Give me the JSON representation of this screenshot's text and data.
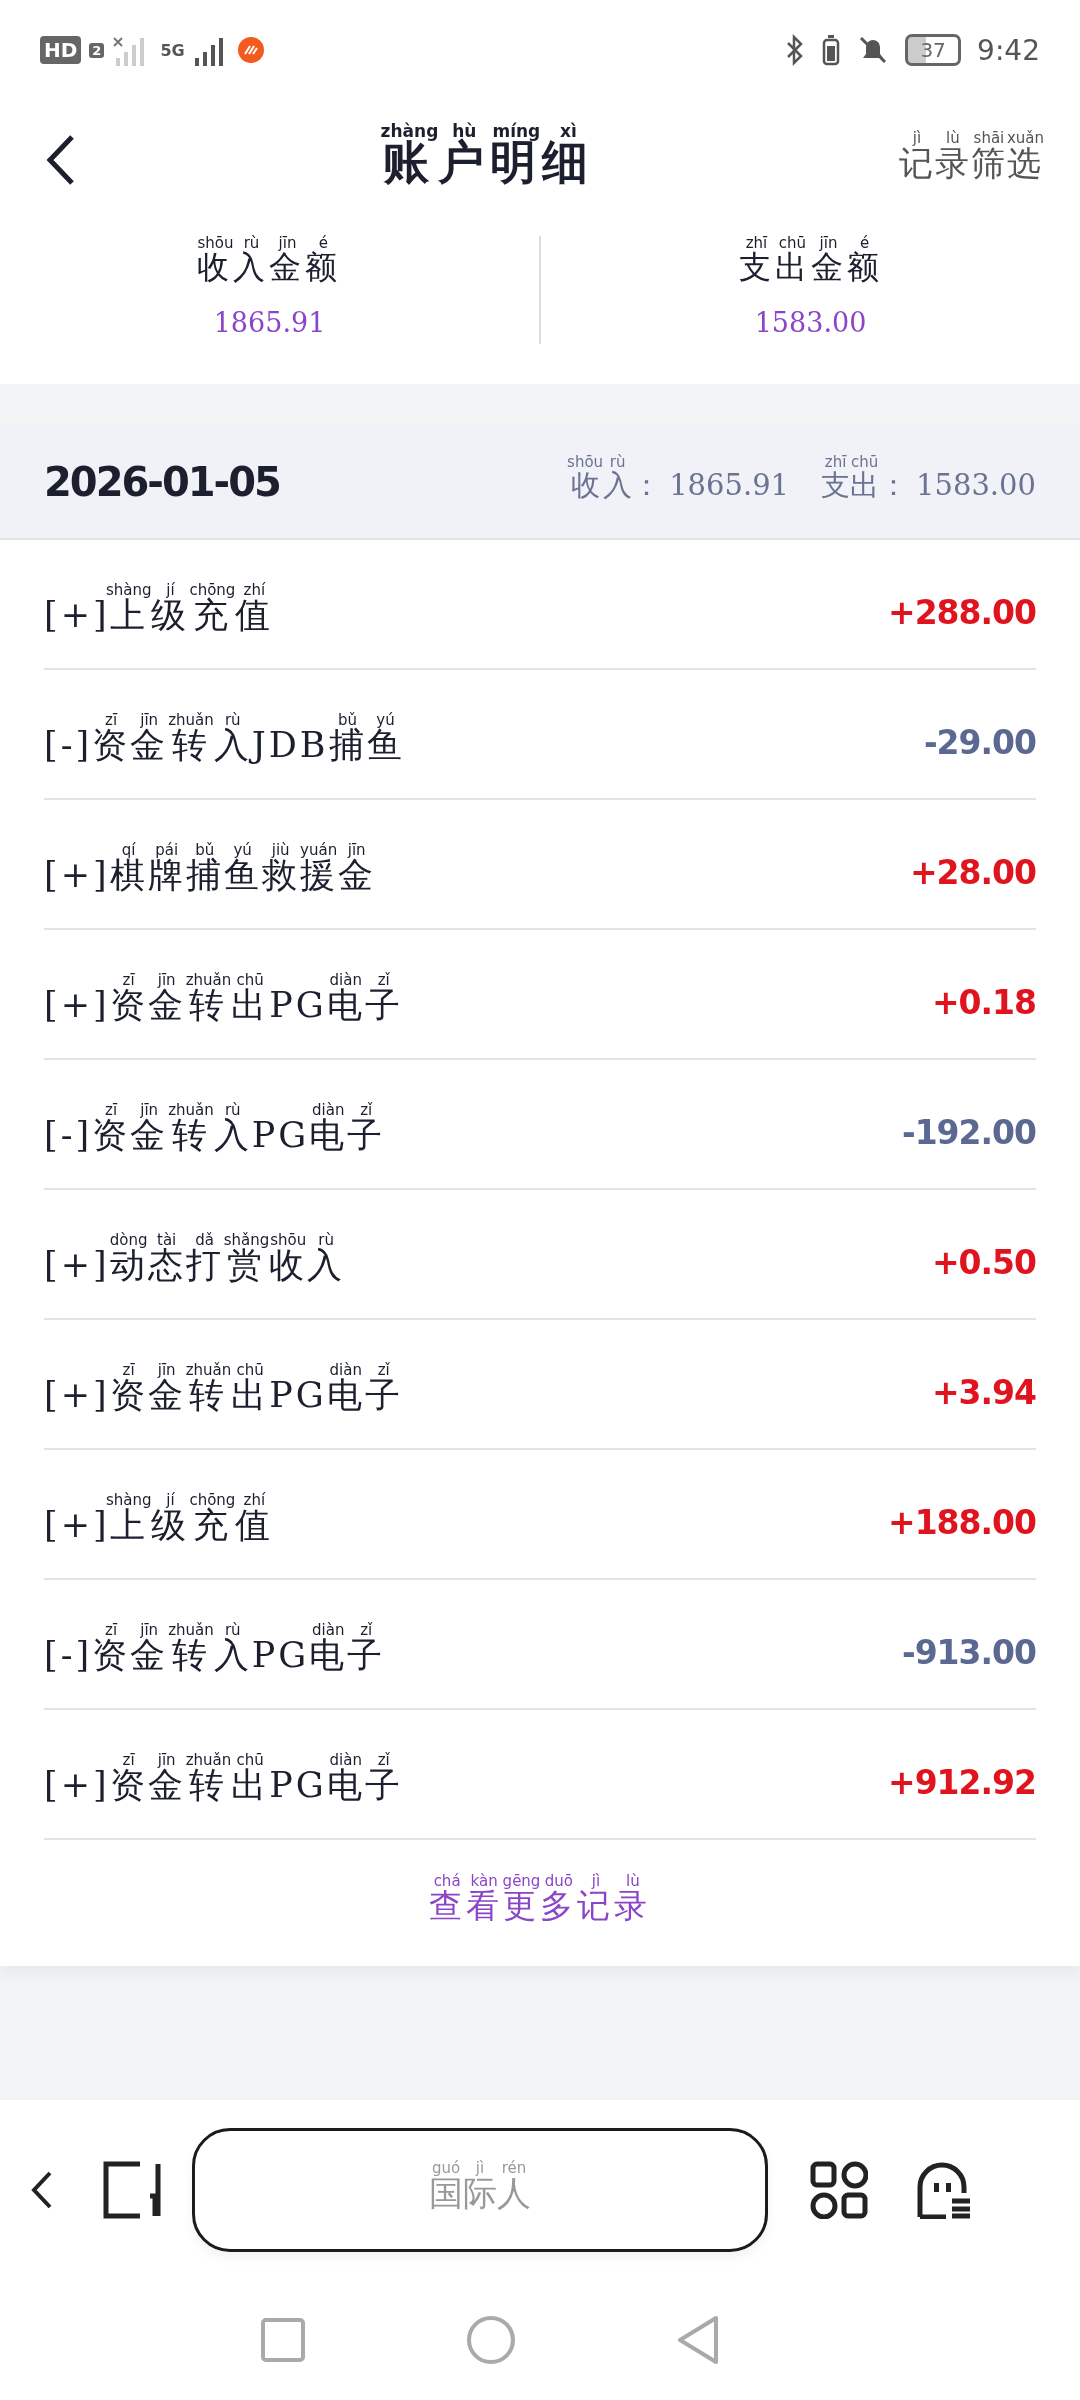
{
  "status_bar": {
    "left": [
      {
        "text": "HD"
      },
      {
        "text": "2"
      },
      {
        "text": "5G"
      }
    ],
    "battery": "37",
    "time": "9:42"
  },
  "header": {
    "title": [
      {
        "text": "账",
        "pinyin": "zhàng"
      },
      {
        "text": "户",
        "pinyin": "hù"
      },
      {
        "text": "明",
        "pinyin": "míng"
      },
      {
        "text": "细",
        "pinyin": "xì"
      }
    ],
    "filter": [
      {
        "text": "记",
        "pinyin": "jì"
      },
      {
        "text": "录",
        "pinyin": "lù"
      },
      {
        "text": "筛",
        "pinyin": "shāi"
      },
      {
        "text": "选",
        "pinyin": "xuǎn"
      }
    ]
  },
  "summary": [
    {
      "label": [
        {
          "text": "收",
          "pinyin": "shōu"
        },
        {
          "text": "入",
          "pinyin": "rù"
        },
        {
          "text": "金",
          "pinyin": "jīn"
        },
        {
          "text": "额",
          "pinyin": "é"
        }
      ],
      "value": "1865.91"
    },
    {
      "label": [
        {
          "text": "支",
          "pinyin": "zhī"
        },
        {
          "text": "出",
          "pinyin": "chū"
        },
        {
          "text": "金",
          "pinyin": "jīn"
        },
        {
          "text": "额",
          "pinyin": "é"
        }
      ],
      "value": "1583.00"
    }
  ],
  "day": {
    "date": "2026-01-05",
    "income_label": [
      {
        "text": "收",
        "pinyin": "shōu"
      },
      {
        "text": "入",
        "pinyin": "rù"
      },
      {
        "text": "："
      }
    ],
    "income": "1865.91",
    "expense_label": [
      {
        "text": "支",
        "pinyin": "zhī"
      },
      {
        "text": "出",
        "pinyin": "chū"
      },
      {
        "text": "："
      }
    ],
    "expense": "1583.00"
  },
  "records": [
    {
      "kind": "income",
      "label": [
        {
          "text": "[+]"
        },
        {
          "text": "上",
          "pinyin": "shàng"
        },
        {
          "text": "级",
          "pinyin": "jí"
        },
        {
          "text": "充",
          "pinyin": "chōng"
        },
        {
          "text": "值",
          "pinyin": "zhí"
        }
      ],
      "amount": "+288.00"
    },
    {
      "kind": "expense",
      "label": [
        {
          "text": "[-]"
        },
        {
          "text": "资",
          "pinyin": "zī"
        },
        {
          "text": "金",
          "pinyin": "jīn"
        },
        {
          "text": "转",
          "pinyin": "zhuǎn"
        },
        {
          "text": "入",
          "pinyin": "rù"
        },
        {
          "text": "JDB"
        },
        {
          "text": "捕",
          "pinyin": "bǔ"
        },
        {
          "text": "鱼",
          "pinyin": "yú"
        }
      ],
      "amount": "-29.00"
    },
    {
      "kind": "income",
      "label": [
        {
          "text": "[+]"
        },
        {
          "text": "棋",
          "pinyin": "qí"
        },
        {
          "text": "牌",
          "pinyin": "pái"
        },
        {
          "text": "捕",
          "pinyin": "bǔ"
        },
        {
          "text": "鱼",
          "pinyin": "yú"
        },
        {
          "text": "救",
          "pinyin": "jiù"
        },
        {
          "text": "援",
          "pinyin": "yuán"
        },
        {
          "text": "金",
          "pinyin": "jīn"
        }
      ],
      "amount": "+28.00"
    },
    {
      "kind": "income",
      "label": [
        {
          "text": "[+]"
        },
        {
          "text": "资",
          "pinyin": "zī"
        },
        {
          "text": "金",
          "pinyin": "jīn"
        },
        {
          "text": "转",
          "pinyin": "zhuǎn"
        },
        {
          "text": "出",
          "pinyin": "chū"
        },
        {
          "text": "PG"
        },
        {
          "text": "电",
          "pinyin": "diàn"
        },
        {
          "text": "子",
          "pinyin": "zǐ"
        }
      ],
      "amount": "+0.18"
    },
    {
      "kind": "expense",
      "label": [
        {
          "text": "[-]"
        },
        {
          "text": "资",
          "pinyin": "zī"
        },
        {
          "text": "金",
          "pinyin": "jīn"
        },
        {
          "text": "转",
          "pinyin": "zhuǎn"
        },
        {
          "text": "入",
          "pinyin": "rù"
        },
        {
          "text": "PG"
        },
        {
          "text": "电",
          "pinyin": "diàn"
        },
        {
          "text": "子",
          "pinyin": "zǐ"
        }
      ],
      "amount": "-192.00"
    },
    {
      "kind": "income",
      "label": [
        {
          "text": "[+]"
        },
        {
          "text": "动",
          "pinyin": "dòng"
        },
        {
          "text": "态",
          "pinyin": "tài"
        },
        {
          "text": "打",
          "pinyin": "dǎ"
        },
        {
          "text": "赏",
          "pinyin": "shǎng"
        },
        {
          "text": "收",
          "pinyin": "shōu"
        },
        {
          "text": "入",
          "pinyin": "rù"
        }
      ],
      "amount": "+0.50"
    },
    {
      "kind": "income",
      "label": [
        {
          "text": "[+]"
        },
        {
          "text": "资",
          "pinyin": "zī"
        },
        {
          "text": "金",
          "pinyin": "jīn"
        },
        {
          "text": "转",
          "pinyin": "zhuǎn"
        },
        {
          "text": "出",
          "pinyin": "chū"
        },
        {
          "text": "PG"
        },
        {
          "text": "电",
          "pinyin": "diàn"
        },
        {
          "text": "子",
          "pinyin": "zǐ"
        }
      ],
      "amount": "+3.94"
    },
    {
      "kind": "income",
      "label": [
        {
          "text": "[+]"
        },
        {
          "text": "上",
          "pinyin": "shàng"
        },
        {
          "text": "级",
          "pinyin": "jí"
        },
        {
          "text": "充",
          "pinyin": "chōng"
        },
        {
          "text": "值",
          "pinyin": "zhí"
        }
      ],
      "amount": "+188.00"
    },
    {
      "kind": "expense",
      "label": [
        {
          "text": "[-]"
        },
        {
          "text": "资",
          "pinyin": "zī"
        },
        {
          "text": "金",
          "pinyin": "jīn"
        },
        {
          "text": "转",
          "pinyin": "zhuǎn"
        },
        {
          "text": "入",
          "pinyin": "rù"
        },
        {
          "text": "PG"
        },
        {
          "text": "电",
          "pinyin": "diàn"
        },
        {
          "text": "子",
          "pinyin": "zǐ"
        }
      ],
      "amount": "-913.00"
    },
    {
      "kind": "income",
      "label": [
        {
          "text": "[+]"
        },
        {
          "text": "资",
          "pinyin": "zī"
        },
        {
          "text": "金",
          "pinyin": "jīn"
        },
        {
          "text": "转",
          "pinyin": "zhuǎn"
        },
        {
          "text": "出",
          "pinyin": "chū"
        },
        {
          "text": "PG"
        },
        {
          "text": "电",
          "pinyin": "diàn"
        },
        {
          "text": "子",
          "pinyin": "zǐ"
        }
      ],
      "amount": "+912.92"
    }
  ],
  "more": [
    {
      "text": "查",
      "pinyin": "chá"
    },
    {
      "text": "看",
      "pinyin": "kàn"
    },
    {
      "text": "更",
      "pinyin": "gēng"
    },
    {
      "text": "多",
      "pinyin": "duō"
    },
    {
      "text": "记",
      "pinyin": "jì"
    },
    {
      "text": "录",
      "pinyin": "lù"
    }
  ],
  "browser_bar": {
    "address": [
      {
        "text": "国",
        "pinyin": "guó"
      },
      {
        "text": "际",
        "pinyin": "jì"
      },
      {
        "text": "人",
        "pinyin": "rén"
      }
    ]
  }
}
